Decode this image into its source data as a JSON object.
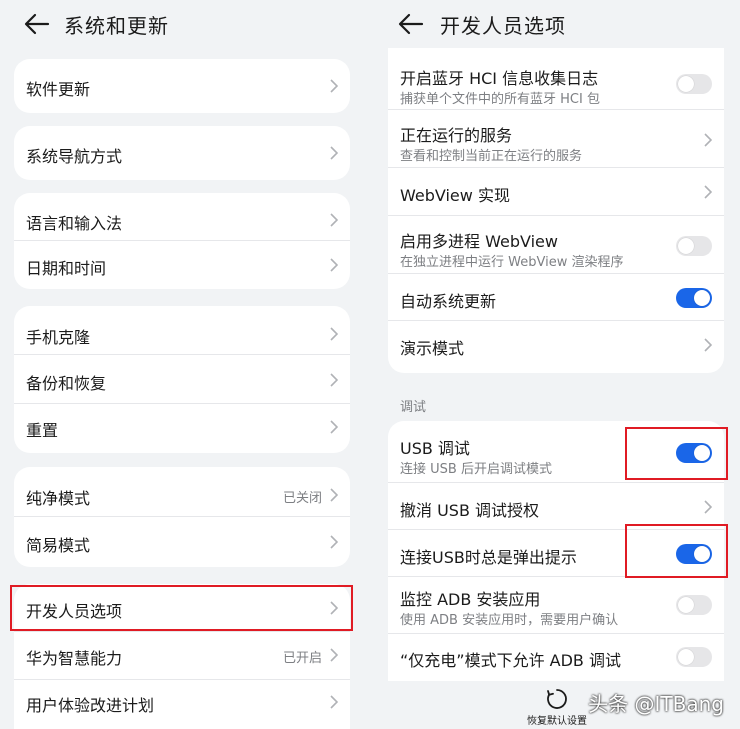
{
  "left": {
    "title": "系统和更新",
    "cards": [
      [
        {
          "label": "软件更新"
        }
      ],
      [
        {
          "label": "系统导航方式"
        }
      ],
      [
        {
          "label": "语言和输入法"
        },
        {
          "label": "日期和时间"
        }
      ],
      [
        {
          "label": "手机克隆"
        },
        {
          "label": "备份和恢复"
        },
        {
          "label": "重置"
        }
      ],
      [
        {
          "label": "纯净模式",
          "value": "已关闭"
        },
        {
          "label": "简易模式"
        }
      ],
      [
        {
          "label": "开发人员选项"
        },
        {
          "label": "华为智慧能力",
          "value": "已开启"
        },
        {
          "label": "用户体验改进计划"
        }
      ]
    ]
  },
  "right": {
    "title": "开发人员选项",
    "card1": [
      {
        "label": "开启蓝牙 HCI 信息收集日志",
        "sub": "捕获单个文件中的所有蓝牙 HCI 包",
        "toggle": false
      },
      {
        "label": "正在运行的服务",
        "sub": "查看和控制当前正在运行的服务"
      },
      {
        "label": "WebView 实现"
      },
      {
        "label": "启用多进程 WebView",
        "sub": "在独立进程中运行 WebView 渲染程序",
        "toggle": false
      },
      {
        "label": "自动系统更新",
        "toggle": true
      },
      {
        "label": "演示模式"
      }
    ],
    "section": "调试",
    "card2": [
      {
        "label": "USB 调试",
        "sub": "连接 USB 后开启调试模式",
        "toggle": true
      },
      {
        "label": "撤消 USB 调试授权"
      },
      {
        "label": "连接USB时总是弹出提示",
        "toggle": true
      },
      {
        "label": "监控 ADB 安装应用",
        "sub": "使用 ADB 安装应用时，需要用户确认",
        "toggle": false
      },
      {
        "label": "“仅充电”模式下允许 ADB 调试",
        "toggle": false
      }
    ],
    "restore_label": "恢复默认设置"
  },
  "watermark": "头条 @ITBang",
  "colors": {
    "accent": "#1a66e8",
    "highlight": "#e01b24",
    "background": "#f1f3f5"
  },
  "icons": {
    "back": "arrow-left-icon",
    "chevron": "chevron-right-icon",
    "restore": "restore-circle-icon"
  }
}
